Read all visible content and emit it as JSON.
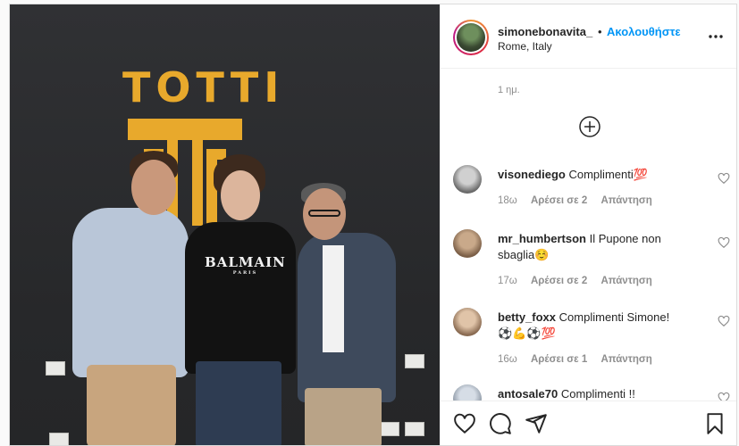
{
  "post": {
    "username": "simonebonavita_",
    "separator": "•",
    "follow_label": "Ακολουθήστε",
    "location": "Rome, Italy",
    "posted_time": "1 ημ.",
    "photo": {
      "wall_logo_text": "TOTTI",
      "shirt_brand": "BALMAIN",
      "shirt_sub": "PARIS"
    }
  },
  "comments": [
    {
      "user": "visonediego",
      "text": "Complimenti💯",
      "time": "18ω",
      "likes": "Αρέσει σε 2",
      "reply": "Απάντηση"
    },
    {
      "user": "mr_humbertson",
      "text": "Il Pupone non sbaglia☺️",
      "time": "17ω",
      "likes": "Αρέσει σε 2",
      "reply": "Απάντηση"
    },
    {
      "user": "betty_foxx",
      "text": "Complimenti Simone! ⚽💪⚽💯",
      "time": "16ω",
      "likes": "Αρέσει σε 1",
      "reply": "Απάντηση"
    },
    {
      "user": "antosale70",
      "text": "Complimenti !!",
      "time": "",
      "likes": "",
      "reply": ""
    }
  ],
  "icons": {
    "more": "more-options-icon",
    "add_comment": "plus-circle-icon",
    "like": "heart-icon",
    "comment": "comment-icon",
    "share": "share-icon",
    "save": "bookmark-icon"
  },
  "colors": {
    "accent": "#0095f6",
    "logo": "#e8a92c",
    "muted": "#8e8e8e"
  }
}
